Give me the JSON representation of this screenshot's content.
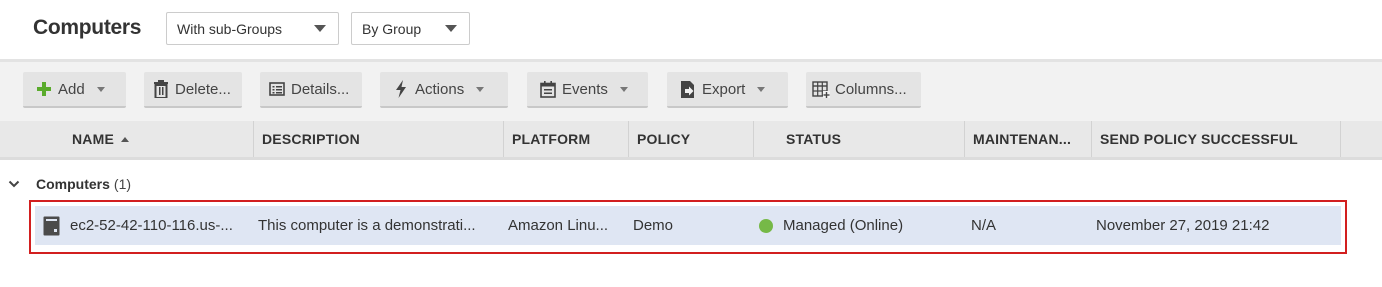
{
  "page": {
    "title": "Computers"
  },
  "filters": {
    "subgroups_label": "With sub-Groups",
    "grouping_label": "By Group"
  },
  "toolbar": {
    "add": "Add",
    "delete": "Delete...",
    "details": "Details...",
    "actions": "Actions",
    "events": "Events",
    "export": "Export",
    "columns": "Columns..."
  },
  "columns": {
    "name": "NAME",
    "description": "DESCRIPTION",
    "platform": "PLATFORM",
    "policy": "POLICY",
    "status": "STATUS",
    "maintenance": "MAINTENAN...",
    "send_policy": "SEND POLICY SUCCESSFUL"
  },
  "group": {
    "name": "Computers",
    "count": "(1)"
  },
  "rows": [
    {
      "name": "ec2-52-42-110-116.us-...",
      "description": "This computer is a demonstrati...",
      "platform": "Amazon Linu...",
      "policy": "Demo",
      "status": "Managed (Online)",
      "maintenance": "N/A",
      "send_policy": "November 27, 2019 21:42",
      "status_color": "#76b947"
    }
  ],
  "colors": {
    "add_icon": "#5aab2c",
    "selected_row": "#dfe6f3",
    "highlight_border": "#d21f1f",
    "status_online": "#76b947"
  },
  "icons": {
    "add": "plus-icon",
    "delete": "trash-icon",
    "details": "list-icon",
    "actions": "lightning-icon",
    "events": "calendar-icon",
    "export": "export-icon",
    "columns": "columns-icon",
    "row": "computer-icon",
    "group_toggle": "chevron-down-icon"
  }
}
